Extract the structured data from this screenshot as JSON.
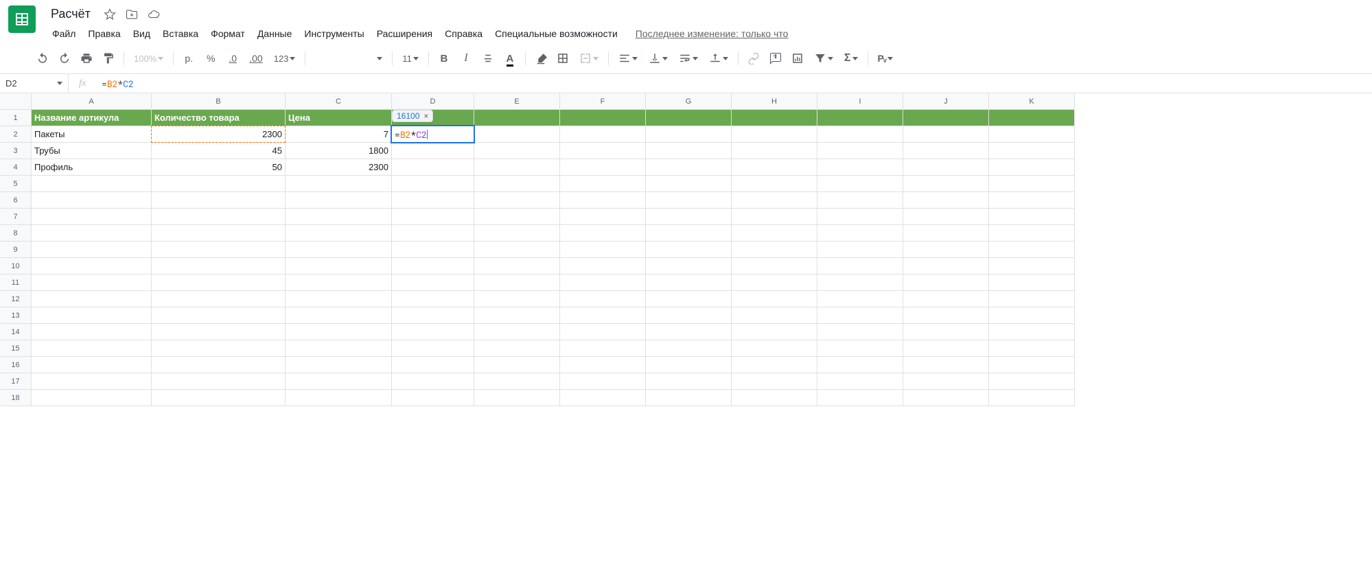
{
  "doc": {
    "title": "Расчёт"
  },
  "menu": {
    "items": [
      "Файл",
      "Правка",
      "Вид",
      "Вставка",
      "Формат",
      "Данные",
      "Инструменты",
      "Расширения",
      "Справка",
      "Специальные возможности"
    ],
    "last_edit": "Последнее изменение: только что"
  },
  "toolbar": {
    "zoom": "100%",
    "currency": "р.",
    "percent": "%",
    "dec_dec": ".0",
    "inc_dec": ".00",
    "more_formats": "123",
    "font_size": "11",
    "bold_glyph": "B",
    "italic_glyph": "I",
    "text_color_glyph": "A",
    "robot": "Рᵥ"
  },
  "formula_bar": {
    "cell_ref": "D2",
    "formula_prefix": "=",
    "formula_ref1": "B2",
    "formula_op": "*",
    "formula_ref2": "C2"
  },
  "columns": [
    "A",
    "B",
    "C",
    "D",
    "E",
    "F",
    "G",
    "H",
    "I",
    "J",
    "K"
  ],
  "rows": [
    "1",
    "2",
    "3",
    "4",
    "5",
    "6",
    "7",
    "8",
    "9",
    "10",
    "11",
    "12",
    "13",
    "14",
    "15",
    "16",
    "17",
    "18"
  ],
  "headers": {
    "a": "Название артикула",
    "b": "Количество товара",
    "c": "Цена"
  },
  "data_rows": [
    {
      "a": "Пакеты",
      "b": "2300",
      "c": "7"
    },
    {
      "a": "Трубы",
      "b": "45",
      "c": "1800"
    },
    {
      "a": "Профиль",
      "b": "50",
      "c": "2300"
    }
  ],
  "editing": {
    "result_preview": "16100",
    "ref1": "B2",
    "op": "*",
    "ref2": "C2"
  }
}
